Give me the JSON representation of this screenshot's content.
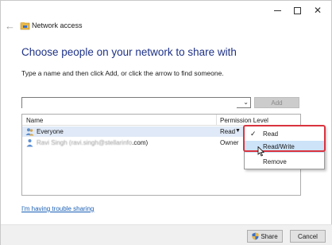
{
  "window": {
    "title": "Network access",
    "icons": [
      "minimize-icon",
      "maximize-icon",
      "close-icon",
      "back-arrow-icon",
      "network-folder-icon"
    ]
  },
  "main": {
    "heading": "Choose people on your network to share with",
    "instruction": "Type a name and then click Add, or click the arrow to find someone.",
    "name_input_value": "",
    "add_label": "Add"
  },
  "list": {
    "columns": [
      "Name",
      "Permission Level"
    ],
    "rows": [
      {
        "name": "Everyone",
        "permission": "Read",
        "icon": "users-icon"
      },
      {
        "name_blurred": "Ravi Singh",
        "email_blurred": "(ravi.singh@stellarinfo",
        "name_suffix": ".com)",
        "permission": "Owner",
        "icon": "user-icon"
      }
    ]
  },
  "permission_menu": {
    "items": [
      "Read",
      "Read/Write",
      "Remove"
    ],
    "checked": "Read",
    "hovered": "Read/Write"
  },
  "footer": {
    "trouble_link": "I'm having trouble sharing",
    "share_label": "Share",
    "cancel_label": "Cancel"
  },
  "colors": {
    "heading": "#1e3287",
    "link": "#1a5fb4",
    "highlight_border": "#d9343f",
    "hover_item": "#cce3f8",
    "selected_row": "#dfe9f7"
  }
}
